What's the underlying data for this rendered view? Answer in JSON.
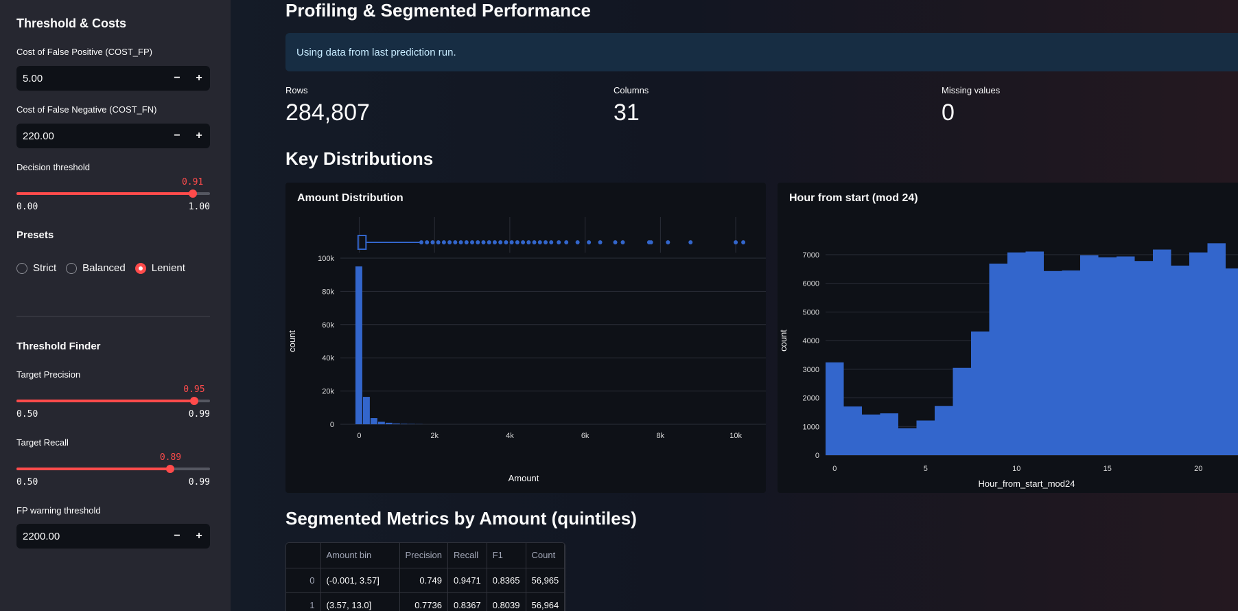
{
  "sidebar": {
    "thresholds_title": "Threshold & Costs",
    "cost_fp": {
      "label": "Cost of False Positive (COST_FP)",
      "value": "5.00"
    },
    "cost_fn": {
      "label": "Cost of False Negative (COST_FN)",
      "value": "220.00"
    },
    "decision": {
      "label": "Decision threshold",
      "value": "0.91",
      "min": "0.00",
      "max": "1.00",
      "fraction": 0.91
    },
    "presets_title": "Presets",
    "presets": [
      "Strict",
      "Balanced",
      "Lenient"
    ],
    "preset_selected": "Lenient",
    "finder_title": "Threshold Finder",
    "target_precision": {
      "label": "Target Precision",
      "value": "0.95",
      "min": "0.50",
      "max": "0.99",
      "fraction": 0.918
    },
    "target_recall": {
      "label": "Target Recall",
      "value": "0.89",
      "min": "0.50",
      "max": "0.99",
      "fraction": 0.796
    },
    "fp_warning": {
      "label": "FP warning threshold",
      "value": "2200.00"
    },
    "minus": "−",
    "plus": "+"
  },
  "main": {
    "title": "Profiling & Segmented Performance",
    "info": "Using data from last prediction run.",
    "metrics": [
      {
        "label": "Rows",
        "value": "284,807"
      },
      {
        "label": "Columns",
        "value": "31"
      },
      {
        "label": "Missing values",
        "value": "0"
      }
    ],
    "dist_title": "Key Distributions",
    "seg_title": "Segmented Metrics by Amount (quintiles)"
  },
  "colors": {
    "bar": "#3366cc",
    "accent": "#ff4b4b",
    "info_bg": "#172d43"
  },
  "chart_data": [
    {
      "type": "bar",
      "title": "Amount Distribution",
      "xlabel": "Amount",
      "ylabel": "count",
      "xlim": [
        -500,
        10800
      ],
      "ylim": [
        0,
        100000
      ],
      "x_ticks": [
        0,
        2000,
        4000,
        6000,
        8000,
        10000
      ],
      "x_tick_labels": [
        "0",
        "2k",
        "4k",
        "6k",
        "8k",
        "10k"
      ],
      "y_ticks": [
        0,
        20000,
        40000,
        60000,
        80000,
        100000
      ],
      "y_tick_labels": [
        "0",
        "20k",
        "40k",
        "60k",
        "80k",
        "100k"
      ],
      "bin_width": 200,
      "bins_start": [
        -100,
        100,
        300,
        500,
        700,
        900,
        1100,
        1300,
        1500
      ],
      "values": [
        95000,
        16500,
        3700,
        1500,
        900,
        500,
        300,
        200,
        100
      ],
      "box_outliers": [
        1650,
        1800,
        1950,
        2100,
        2250,
        2400,
        2550,
        2700,
        2850,
        3000,
        3150,
        3300,
        3450,
        3600,
        3750,
        3900,
        4050,
        4200,
        4350,
        4500,
        4650,
        4800,
        4950,
        5100,
        5300,
        5500,
        5800,
        6100,
        6400,
        6800,
        7000,
        7700,
        7750,
        8200,
        8800,
        10000,
        10200
      ]
    },
    {
      "type": "bar",
      "title": "Hour from start (mod 24)",
      "xlabel": "Hour_from_start_mod24",
      "ylabel": "count",
      "xlim": [
        -0.5,
        23.5
      ],
      "ylim": [
        0,
        7600
      ],
      "x_ticks": [
        0,
        5,
        10,
        15,
        20
      ],
      "y_ticks": [
        0,
        1000,
        2000,
        3000,
        4000,
        5000,
        6000,
        7000
      ],
      "categories": [
        0,
        1,
        2,
        3,
        4,
        5,
        6,
        7,
        8,
        9,
        10,
        11,
        12,
        13,
        14,
        15,
        16,
        17,
        18,
        19,
        20,
        21,
        22
      ],
      "values": [
        3240,
        1700,
        1420,
        1460,
        940,
        1210,
        1720,
        3050,
        4320,
        6690,
        7080,
        7110,
        6430,
        6450,
        6980,
        6910,
        6940,
        6780,
        7180,
        6620,
        7080,
        7400,
        6520
      ]
    }
  ],
  "table": {
    "columns": [
      "",
      "Amount bin",
      "Precision",
      "Recall",
      "F1",
      "Count"
    ],
    "rows": [
      [
        "0",
        "(-0.001, 3.57]",
        "0.749",
        "0.9471",
        "0.8365",
        "56,965"
      ],
      [
        "1",
        "(3.57, 13.0]",
        "0.7736",
        "0.8367",
        "0.8039",
        "56,964"
      ]
    ]
  }
}
